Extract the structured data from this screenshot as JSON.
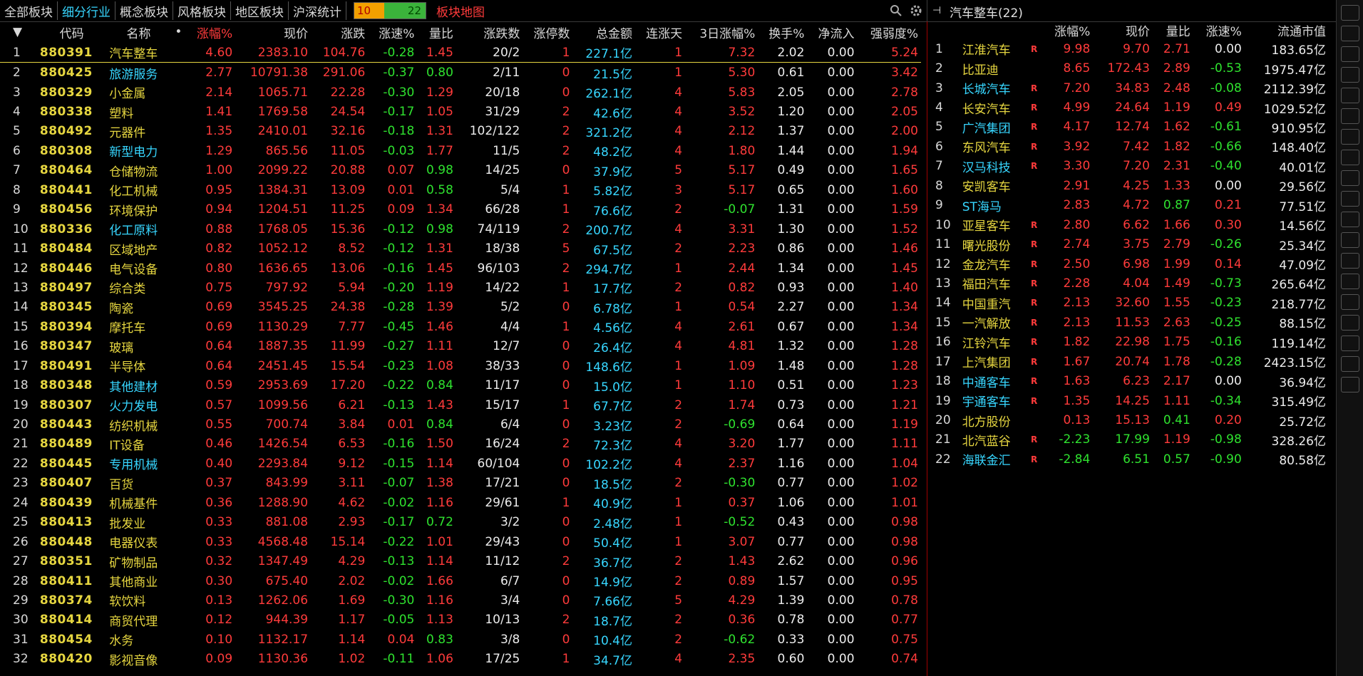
{
  "tabs": [
    "全部板块",
    "细分行业",
    "概念板块",
    "风格板块",
    "地区板块",
    "沪深统计"
  ],
  "active_tab": 1,
  "ratio": {
    "up": "10",
    "down": "22"
  },
  "map_link": "板块地图",
  "left_headers": [
    "",
    "代码",
    "名称",
    "•",
    "涨幅%",
    "现价",
    "涨跌",
    "涨速%",
    "量比",
    "涨跌数",
    "涨停数",
    "总金额",
    "连涨天",
    "3日涨幅%",
    "换手%",
    "净流入",
    "强弱度%"
  ],
  "left_rows": [
    [
      "1",
      "880391",
      "汽车整车",
      "4.60",
      "2383.10",
      "104.76",
      "-0.28",
      "1.45",
      "20/2",
      "1",
      "227.1亿",
      "1",
      "7.32",
      "2.02",
      "0.00",
      "5.24"
    ],
    [
      "2",
      "880425",
      "旅游服务",
      "2.77",
      "10791.38",
      "291.06",
      "-0.37",
      "0.80",
      "2/11",
      "0",
      "21.5亿",
      "1",
      "5.30",
      "0.61",
      "0.00",
      "3.42"
    ],
    [
      "3",
      "880329",
      "小金属",
      "2.14",
      "1065.71",
      "22.28",
      "-0.30",
      "1.29",
      "20/18",
      "0",
      "262.1亿",
      "4",
      "5.83",
      "2.05",
      "0.00",
      "2.78"
    ],
    [
      "4",
      "880338",
      "塑料",
      "1.41",
      "1769.58",
      "24.54",
      "-0.17",
      "1.05",
      "31/29",
      "2",
      "42.6亿",
      "4",
      "3.52",
      "1.20",
      "0.00",
      "2.05"
    ],
    [
      "5",
      "880492",
      "元器件",
      "1.35",
      "2410.01",
      "32.16",
      "-0.18",
      "1.31",
      "102/122",
      "2",
      "321.2亿",
      "4",
      "2.12",
      "1.37",
      "0.00",
      "2.00"
    ],
    [
      "6",
      "880308",
      "新型电力",
      "1.29",
      "865.56",
      "11.05",
      "-0.03",
      "1.77",
      "11/5",
      "2",
      "48.2亿",
      "4",
      "1.80",
      "1.44",
      "0.00",
      "1.94"
    ],
    [
      "7",
      "880464",
      "仓储物流",
      "1.00",
      "2099.22",
      "20.88",
      "0.07",
      "0.98",
      "14/25",
      "0",
      "37.9亿",
      "5",
      "5.17",
      "0.49",
      "0.00",
      "1.65"
    ],
    [
      "8",
      "880441",
      "化工机械",
      "0.95",
      "1384.31",
      "13.09",
      "0.01",
      "0.58",
      "5/4",
      "1",
      "5.82亿",
      "3",
      "5.17",
      "0.65",
      "0.00",
      "1.60"
    ],
    [
      "9",
      "880456",
      "环境保护",
      "0.94",
      "1204.51",
      "11.25",
      "0.09",
      "1.34",
      "66/28",
      "1",
      "76.6亿",
      "2",
      "-0.07",
      "1.31",
      "0.00",
      "1.59"
    ],
    [
      "10",
      "880336",
      "化工原料",
      "0.88",
      "1768.05",
      "15.36",
      "-0.12",
      "0.98",
      "74/119",
      "2",
      "200.7亿",
      "4",
      "3.31",
      "1.30",
      "0.00",
      "1.52"
    ],
    [
      "11",
      "880484",
      "区域地产",
      "0.82",
      "1052.12",
      "8.52",
      "-0.12",
      "1.31",
      "18/38",
      "5",
      "67.5亿",
      "2",
      "2.23",
      "0.86",
      "0.00",
      "1.46"
    ],
    [
      "12",
      "880446",
      "电气设备",
      "0.80",
      "1636.65",
      "13.06",
      "-0.16",
      "1.45",
      "96/103",
      "2",
      "294.7亿",
      "1",
      "2.44",
      "1.34",
      "0.00",
      "1.45"
    ],
    [
      "13",
      "880497",
      "综合类",
      "0.75",
      "797.92",
      "5.94",
      "-0.20",
      "1.19",
      "14/22",
      "1",
      "17.7亿",
      "2",
      "0.82",
      "0.93",
      "0.00",
      "1.40"
    ],
    [
      "14",
      "880345",
      "陶瓷",
      "0.69",
      "3545.25",
      "24.38",
      "-0.28",
      "1.39",
      "5/2",
      "0",
      "6.78亿",
      "1",
      "0.54",
      "2.27",
      "0.00",
      "1.34"
    ],
    [
      "15",
      "880394",
      "摩托车",
      "0.69",
      "1130.29",
      "7.77",
      "-0.45",
      "1.46",
      "4/4",
      "1",
      "4.56亿",
      "4",
      "2.61",
      "0.67",
      "0.00",
      "1.34"
    ],
    [
      "16",
      "880347",
      "玻璃",
      "0.64",
      "1887.35",
      "11.99",
      "-0.27",
      "1.11",
      "12/7",
      "0",
      "26.4亿",
      "4",
      "4.81",
      "1.32",
      "0.00",
      "1.28"
    ],
    [
      "17",
      "880491",
      "半导体",
      "0.64",
      "2451.45",
      "15.54",
      "-0.23",
      "1.08",
      "38/33",
      "0",
      "148.6亿",
      "1",
      "1.09",
      "1.48",
      "0.00",
      "1.28"
    ],
    [
      "18",
      "880348",
      "其他建材",
      "0.59",
      "2953.69",
      "17.20",
      "-0.22",
      "0.84",
      "11/17",
      "0",
      "15.0亿",
      "1",
      "1.10",
      "0.51",
      "0.00",
      "1.23"
    ],
    [
      "19",
      "880307",
      "火力发电",
      "0.57",
      "1099.56",
      "6.21",
      "-0.13",
      "1.43",
      "15/17",
      "1",
      "67.7亿",
      "2",
      "1.74",
      "0.73",
      "0.00",
      "1.21"
    ],
    [
      "20",
      "880443",
      "纺织机械",
      "0.55",
      "700.74",
      "3.84",
      "0.01",
      "0.84",
      "6/4",
      "0",
      "3.23亿",
      "2",
      "-0.69",
      "0.64",
      "0.00",
      "1.19"
    ],
    [
      "21",
      "880489",
      "IT设备",
      "0.46",
      "1426.54",
      "6.53",
      "-0.16",
      "1.50",
      "16/24",
      "2",
      "72.3亿",
      "4",
      "3.20",
      "1.77",
      "0.00",
      "1.11"
    ],
    [
      "22",
      "880445",
      "专用机械",
      "0.40",
      "2293.84",
      "9.12",
      "-0.15",
      "1.14",
      "60/104",
      "0",
      "102.2亿",
      "4",
      "2.37",
      "1.16",
      "0.00",
      "1.04"
    ],
    [
      "23",
      "880407",
      "百货",
      "0.37",
      "843.99",
      "3.11",
      "-0.07",
      "1.38",
      "17/21",
      "0",
      "18.5亿",
      "2",
      "-0.30",
      "0.77",
      "0.00",
      "1.02"
    ],
    [
      "24",
      "880439",
      "机械基件",
      "0.36",
      "1288.90",
      "4.62",
      "-0.02",
      "1.16",
      "29/61",
      "1",
      "40.9亿",
      "1",
      "0.37",
      "1.06",
      "0.00",
      "1.01"
    ],
    [
      "25",
      "880413",
      "批发业",
      "0.33",
      "881.08",
      "2.93",
      "-0.17",
      "0.72",
      "3/2",
      "0",
      "2.48亿",
      "1",
      "-0.52",
      "0.43",
      "0.00",
      "0.98"
    ],
    [
      "26",
      "880448",
      "电器仪表",
      "0.33",
      "4568.48",
      "15.14",
      "-0.22",
      "1.01",
      "29/43",
      "0",
      "50.4亿",
      "1",
      "3.07",
      "0.77",
      "0.00",
      "0.98"
    ],
    [
      "27",
      "880351",
      "矿物制品",
      "0.32",
      "1347.49",
      "4.29",
      "-0.13",
      "1.14",
      "11/12",
      "2",
      "36.7亿",
      "2",
      "1.43",
      "2.62",
      "0.00",
      "0.96"
    ],
    [
      "28",
      "880411",
      "其他商业",
      "0.30",
      "675.40",
      "2.02",
      "-0.02",
      "1.66",
      "6/7",
      "0",
      "14.9亿",
      "2",
      "0.89",
      "1.57",
      "0.00",
      "0.95"
    ],
    [
      "29",
      "880374",
      "软饮料",
      "0.13",
      "1262.06",
      "1.69",
      "-0.30",
      "1.16",
      "3/4",
      "0",
      "7.66亿",
      "5",
      "4.29",
      "1.39",
      "0.00",
      "0.78"
    ],
    [
      "30",
      "880414",
      "商贸代理",
      "0.12",
      "944.39",
      "1.17",
      "-0.05",
      "1.13",
      "10/13",
      "2",
      "18.7亿",
      "2",
      "0.36",
      "0.78",
      "0.00",
      "0.77"
    ],
    [
      "31",
      "880454",
      "水务",
      "0.10",
      "1132.17",
      "1.14",
      "0.04",
      "0.83",
      "3/8",
      "0",
      "10.4亿",
      "2",
      "-0.62",
      "0.33",
      "0.00",
      "0.75"
    ],
    [
      "32",
      "880420",
      "影视音像",
      "0.09",
      "1130.36",
      "1.02",
      "-0.11",
      "1.06",
      "17/25",
      "1",
      "34.7亿",
      "4",
      "2.35",
      "0.60",
      "0.00",
      "0.74"
    ]
  ],
  "left_cyan_names": [
    1,
    5,
    9,
    17,
    18,
    21
  ],
  "right_title": "汽车整车(22)",
  "right_headers": [
    "",
    "涨幅%",
    "现价",
    "量比",
    "涨速%",
    "流通市值"
  ],
  "right_rows": [
    [
      "1",
      "江淮汽车",
      "R",
      "9.98",
      "9.70",
      "2.71",
      "0.00",
      "183.65亿"
    ],
    [
      "2",
      "比亚迪",
      "",
      "8.65",
      "172.43",
      "2.89",
      "-0.53",
      "1975.47亿"
    ],
    [
      "3",
      "长城汽车",
      "R",
      "7.20",
      "34.83",
      "2.48",
      "-0.08",
      "2112.39亿"
    ],
    [
      "4",
      "长安汽车",
      "R",
      "4.99",
      "24.64",
      "1.19",
      "0.49",
      "1029.52亿"
    ],
    [
      "5",
      "广汽集团",
      "R",
      "4.17",
      "12.74",
      "1.62",
      "-0.61",
      "910.95亿"
    ],
    [
      "6",
      "东风汽车",
      "R",
      "3.92",
      "7.42",
      "1.82",
      "-0.66",
      "148.40亿"
    ],
    [
      "7",
      "汉马科技",
      "R",
      "3.30",
      "7.20",
      "2.31",
      "-0.40",
      "40.01亿"
    ],
    [
      "8",
      "安凯客车",
      "",
      "2.91",
      "4.25",
      "1.33",
      "0.00",
      "29.56亿"
    ],
    [
      "9",
      "ST海马",
      "",
      "2.83",
      "4.72",
      "0.87",
      "0.21",
      "77.51亿"
    ],
    [
      "10",
      "亚星客车",
      "R",
      "2.80",
      "6.62",
      "1.66",
      "0.30",
      "14.56亿"
    ],
    [
      "11",
      "曙光股份",
      "R",
      "2.74",
      "3.75",
      "2.79",
      "-0.26",
      "25.34亿"
    ],
    [
      "12",
      "金龙汽车",
      "R",
      "2.50",
      "6.98",
      "1.99",
      "0.14",
      "47.09亿"
    ],
    [
      "13",
      "福田汽车",
      "R",
      "2.28",
      "4.04",
      "1.49",
      "-0.73",
      "265.64亿"
    ],
    [
      "14",
      "中国重汽",
      "R",
      "2.13",
      "32.60",
      "1.55",
      "-0.23",
      "218.77亿"
    ],
    [
      "15",
      "一汽解放",
      "R",
      "2.13",
      "11.53",
      "2.63",
      "-0.25",
      "88.15亿"
    ],
    [
      "16",
      "江铃汽车",
      "R",
      "1.82",
      "22.98",
      "1.75",
      "-0.16",
      "119.14亿"
    ],
    [
      "17",
      "上汽集团",
      "R",
      "1.67",
      "20.74",
      "1.78",
      "-0.28",
      "2423.15亿"
    ],
    [
      "18",
      "中通客车",
      "R",
      "1.63",
      "6.23",
      "2.17",
      "0.00",
      "36.94亿"
    ],
    [
      "19",
      "宇通客车",
      "R",
      "1.35",
      "14.25",
      "1.11",
      "-0.34",
      "315.49亿"
    ],
    [
      "20",
      "北方股份",
      "",
      "0.13",
      "15.13",
      "0.41",
      "0.20",
      "25.72亿"
    ],
    [
      "21",
      "北汽蓝谷",
      "R",
      "-2.23",
      "17.99",
      "1.19",
      "-0.98",
      "328.26亿"
    ],
    [
      "22",
      "海联金汇",
      "R",
      "-2.84",
      "6.51",
      "0.57",
      "-0.90",
      "80.58亿"
    ]
  ],
  "right_cyan_names": [
    2,
    4,
    6,
    8,
    17,
    18,
    21
  ],
  "colors": {
    "up": "#ff3b3b",
    "down": "#2fe22f",
    "code": "#e6d640",
    "cyan": "#37d6ff"
  }
}
